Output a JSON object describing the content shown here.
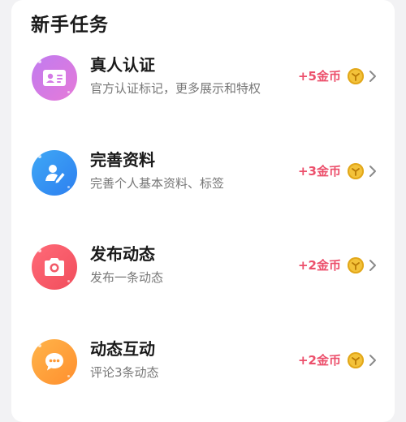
{
  "section": {
    "title": "新手任务"
  },
  "tasks": [
    {
      "name": "真人认证",
      "desc": "官方认证标记，更多展示和特权",
      "reward": "+5金币",
      "icon": "id-card-icon",
      "gradient": [
        "#c07bf0",
        "#e67ad8"
      ]
    },
    {
      "name": "完善资料",
      "desc": "完善个人基本资料、标签",
      "reward": "+3金币",
      "icon": "edit-profile-icon",
      "gradient": [
        "#3fa8f5",
        "#2d7ff0"
      ]
    },
    {
      "name": "发布动态",
      "desc": "发布一条动态",
      "reward": "+2金币",
      "icon": "camera-icon",
      "gradient": [
        "#ff6a78",
        "#f14d5c"
      ]
    },
    {
      "name": "动态互动",
      "desc": "评论3条动态",
      "reward": "+2金币",
      "icon": "chat-bubble-icon",
      "gradient": [
        "#ffb44a",
        "#ff8f2e"
      ]
    }
  ],
  "colors": {
    "reward": "#ec4f6b",
    "coin": "#f3c23a",
    "chevron": "#8a8a8a"
  }
}
